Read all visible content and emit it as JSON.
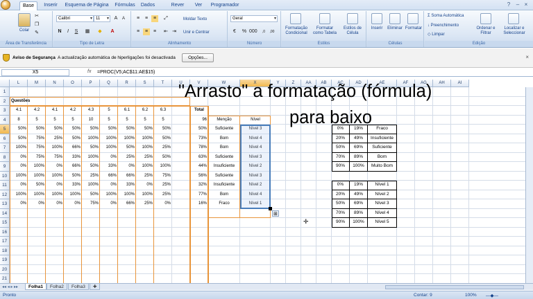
{
  "tabs": [
    "Base",
    "Inserir",
    "Esquema de Página",
    "Fórmulas",
    "Dados",
    "Rever",
    "Ver",
    "Programador"
  ],
  "ribbon": {
    "clipboard": {
      "paste": "Colar",
      "label": "Área de Transferência"
    },
    "font": {
      "name": "Calibri",
      "size": "11",
      "label": "Tipo de Letra"
    },
    "alignment": {
      "wrap": "Moldar Texto",
      "merge": "Unir e Centrar",
      "label": "Alinhamento"
    },
    "number": {
      "format": "Geral",
      "label": "Número"
    },
    "styles": {
      "cond": "Formatação Condicional",
      "table": "Formatar como Tabela",
      "cell": "Estilos de Célula",
      "label": "Estilos"
    },
    "cells": {
      "insert": "Inserir",
      "delete": "Eliminar",
      "format": "Formatar",
      "label": "Células"
    },
    "editing": {
      "autosum": "Soma Automática",
      "fill": "Preenchimento",
      "clear": "Limpar",
      "sort": "Ordenar e Filtrar",
      "find": "Localizar e Seleccionar",
      "label": "Edição"
    }
  },
  "security": {
    "title": "Aviso de Segurança",
    "message": "A actualização automática de hiperligações foi desactivada",
    "options": "Opções..."
  },
  "formula_bar": {
    "name_box": "X5",
    "fx": "fx",
    "formula": "=PROC(V5;AC$11:AE$15)"
  },
  "columns": [
    "L",
    "M",
    "N",
    "O",
    "P",
    "Q",
    "R",
    "S",
    "T",
    "U",
    "V",
    "W",
    "X",
    "Y",
    "Z",
    "AA",
    "AB",
    "AC",
    "AD",
    "AE",
    "AF",
    "AG",
    "AH",
    "AI"
  ],
  "rows": [
    "1",
    "2",
    "3",
    "4",
    "5",
    "6",
    "7",
    "8",
    "9",
    "10",
    "11",
    "12",
    "13",
    "14",
    "15",
    "16",
    "17",
    "18",
    "19",
    "20",
    "21"
  ],
  "sheet": {
    "questoes": "Questões",
    "questions": [
      "4.1",
      "4.2",
      "4.1",
      "4.2",
      "4.3",
      "5",
      "6.1",
      "6.2",
      "6.3"
    ],
    "weights": [
      "8",
      "5",
      "5",
      "5",
      "10",
      "5",
      "5",
      "5",
      "5"
    ],
    "total_label": "Total",
    "total_value": "96",
    "mencao_label": "Menção",
    "nivel_label": "Nível",
    "data": [
      [
        "50%",
        "50%",
        "50%",
        "50%",
        "50%",
        "50%",
        "50%",
        "50%",
        "50%"
      ],
      [
        "50%",
        "75%",
        "25%",
        "50%",
        "100%",
        "100%",
        "100%",
        "100%",
        "50%"
      ],
      [
        "100%",
        "75%",
        "100%",
        "66%",
        "50%",
        "100%",
        "50%",
        "100%",
        "25%"
      ],
      [
        "0%",
        "75%",
        "75%",
        "33%",
        "100%",
        "0%",
        "25%",
        "25%",
        "50%"
      ],
      [
        "0%",
        "100%",
        "0%",
        "66%",
        "50%",
        "33%",
        "0%",
        "100%",
        "100%"
      ],
      [
        "100%",
        "100%",
        "100%",
        "50%",
        "25%",
        "66%",
        "66%",
        "25%",
        "75%"
      ],
      [
        "0%",
        "50%",
        "0%",
        "33%",
        "100%",
        "0%",
        "33%",
        "0%",
        "25%"
      ],
      [
        "100%",
        "100%",
        "100%",
        "100%",
        "50%",
        "100%",
        "100%",
        "100%",
        "25%"
      ],
      [
        "0%",
        "0%",
        "0%",
        "0%",
        "75%",
        "0%",
        "66%",
        "25%",
        "0%"
      ]
    ],
    "totals": [
      "50%",
      "73%",
      "78%",
      "63%",
      "44%",
      "56%",
      "32%",
      "77%",
      "16%"
    ],
    "mencoes": [
      "Suficiente",
      "Bom",
      "Bom",
      "Suficiente",
      "Insuficiente",
      "Suficiente",
      "Insuficiente",
      "Bom",
      "Fraco"
    ],
    "niveis": [
      "Nível 3",
      "Nível 4",
      "Nível 4",
      "Nível 3",
      "Nível 2",
      "Nível 3",
      "Nível 2",
      "Nível 4",
      "Nível 1"
    ],
    "table1": [
      [
        "0%",
        "19%",
        "Fraco"
      ],
      [
        "20%",
        "49%",
        "Insuficiente"
      ],
      [
        "50%",
        "69%",
        "Suficiente"
      ],
      [
        "70%",
        "89%",
        "Bom"
      ],
      [
        "90%",
        "100%",
        "Muito Bom"
      ]
    ],
    "table2": [
      [
        "0%",
        "19%",
        "Nível 1"
      ],
      [
        "20%",
        "49%",
        "Nível 2"
      ],
      [
        "50%",
        "69%",
        "Nível 3"
      ],
      [
        "70%",
        "89%",
        "Nível 4"
      ],
      [
        "90%",
        "100%",
        "Nível 5"
      ]
    ]
  },
  "overlay": {
    "line1": "\"Arrasto\" a formatação (fórmula)",
    "line2": "para baixo"
  },
  "sheet_tabs": [
    "Folha1",
    "Folha2",
    "Folha3"
  ],
  "status": {
    "ready": "Pronto",
    "count": "Contar: 9",
    "zoom": "100%"
  }
}
